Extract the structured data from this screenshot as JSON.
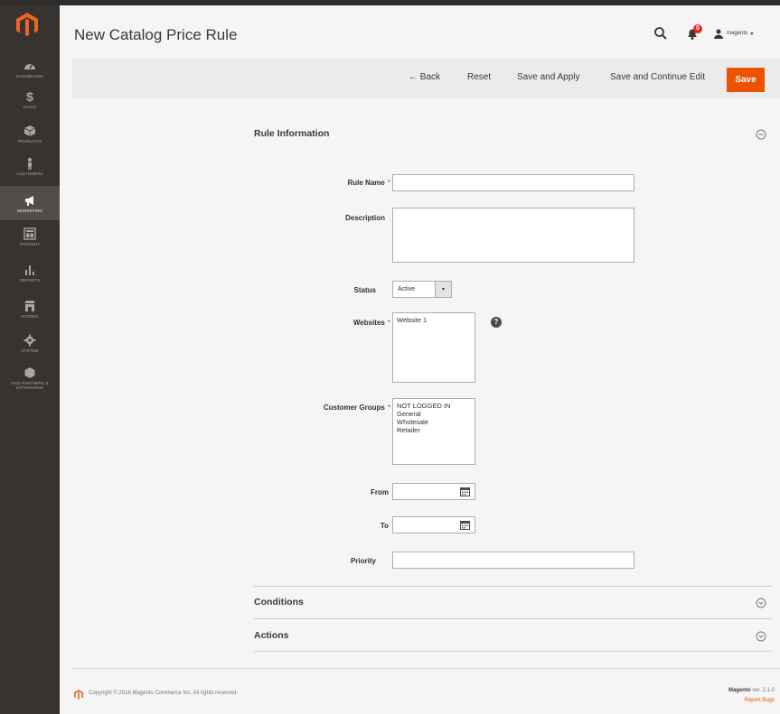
{
  "page": {
    "title": "New Catalog Price Rule"
  },
  "header": {
    "notification_count": "0",
    "user_name": "magento"
  },
  "sidebar": {
    "items": [
      {
        "label": "Dashboard",
        "icon": "dashboard-icon"
      },
      {
        "label": "Sales",
        "icon": "dollar-icon"
      },
      {
        "label": "Products",
        "icon": "cube-icon"
      },
      {
        "label": "Customers",
        "icon": "person-icon"
      },
      {
        "label": "Marketing",
        "icon": "megaphone-icon"
      },
      {
        "label": "Content",
        "icon": "layout-icon"
      },
      {
        "label": "Reports",
        "icon": "bar-chart-icon"
      },
      {
        "label": "Stores",
        "icon": "store-icon"
      },
      {
        "label": "System",
        "icon": "gear-icon"
      },
      {
        "label": "Find Partners & Extensions",
        "icon": "hexagon-icon"
      }
    ]
  },
  "actions": {
    "back": "← Back",
    "reset": "Reset",
    "save_apply": "Save and Apply",
    "save_continue": "Save and Continue Edit",
    "save": "Save"
  },
  "sections": {
    "rule_info": "Rule Information",
    "conditions": "Conditions",
    "actions": "Actions"
  },
  "form": {
    "rule_name_label": "Rule Name",
    "rule_name_value": "",
    "description_label": "Description",
    "description_value": "",
    "status_label": "Status",
    "status_value": "Active",
    "websites_label": "Websites",
    "websites_options": [
      "Website 1"
    ],
    "customer_groups_label": "Customer Groups",
    "customer_groups_options": [
      "NOT LOGGED IN",
      "General",
      "Wholesale",
      "Retailer"
    ],
    "from_label": "From",
    "from_value": "",
    "to_label": "To",
    "to_value": "",
    "priority_label": "Priority",
    "priority_value": ""
  },
  "footer": {
    "copyright": "Copyright © 2016 Magento Commerce Inc. All rights reserved.",
    "brand": "Magento",
    "version": "ver. 2.1.0",
    "report": "Report Bugs"
  },
  "colors": {
    "accent": "#eb5202",
    "sidebar_bg": "#373330",
    "required": "#e22626"
  }
}
